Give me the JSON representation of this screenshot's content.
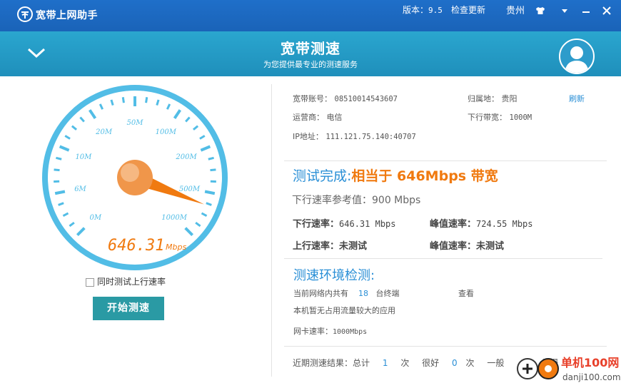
{
  "titlebar": {
    "app_name": "宽带上网助手",
    "version_label": "版本：",
    "version_value": "9.5",
    "update_label": "检查更新",
    "city": "贵州"
  },
  "banner": {
    "title": "宽带测速",
    "subtitle": "为您提供最专业的测速服务"
  },
  "gauge": {
    "ticks": [
      "0M",
      "6M",
      "10M",
      "20M",
      "50M",
      "100M",
      "200M",
      "500M",
      "1000M"
    ],
    "reading": "646.31",
    "unit": "Mbps",
    "needle_value_mbps": 646.31
  },
  "controls": {
    "upload_checkbox_label": "同时测试上行速率",
    "start_button_label": "开始测速"
  },
  "account": {
    "account_label": "宽带账号：",
    "account_value": "08510014543607",
    "region_label": "归属地：",
    "region_value": "贵阳",
    "refresh_label": "刷新",
    "isp_label": "运营商：",
    "isp_value": "电信",
    "bandwidth_label": "下行带宽：",
    "bandwidth_value": "1000M",
    "ip_label": "IP地址：",
    "ip_value": "111.121.75.140:40707"
  },
  "result": {
    "done_label": "测试完成:",
    "summary": "相当于 646Mbps 带宽",
    "ref_label": "下行速率参考值：",
    "ref_value": "900 Mbps",
    "down_label": "下行速率：",
    "down_value": "646.31 Mbps",
    "peak_label": "峰值速率：",
    "peak_value": "724.55 Mbps",
    "up_label": "上行速率：",
    "up_value": "未测试",
    "peak2_label": "峰值速率：",
    "peak2_value": "未测试"
  },
  "environment": {
    "title": "测速环境检测:",
    "lan_prefix": "当前网络内共有",
    "lan_count": "18",
    "lan_suffix": "台终端",
    "view_label": "查看",
    "traffic_note": "本机暂无占用流量较大的应用",
    "nic_label": "网卡速率：",
    "nic_value": "1000Mbps"
  },
  "footer": {
    "recent_label": "近期测速结果：总计",
    "total_count": "1",
    "times1": "次",
    "good_label": "很好",
    "good_count": "0",
    "times2": "次",
    "normal_label": "一般",
    "partial": "偏慢"
  },
  "watermark": {
    "name": "单机100网",
    "url": "danji100.com"
  },
  "colors": {
    "titlebar": "#1f6fc9",
    "banner": "#26a0cc",
    "accent_blue": "#2a8fd6",
    "accent_orange": "#f07a10",
    "button": "#2a9aa4",
    "gauge_ring": "#52bde6"
  }
}
